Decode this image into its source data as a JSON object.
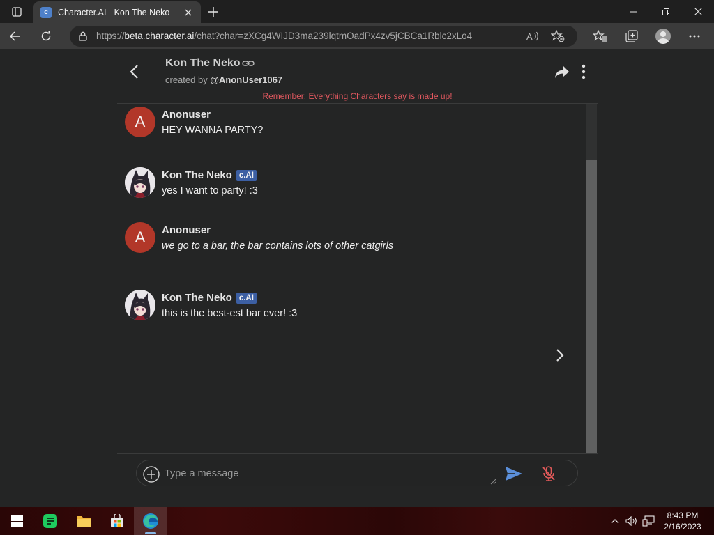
{
  "browser": {
    "tab_title": "Character.AI - Kon The Neko",
    "url_scheme": "https://",
    "url_host": "beta.character.ai",
    "url_path": "/chat?char=zXCg4WIJD3ma239lqtmOadPx4zv5jCBCa1Rblc2xLo4"
  },
  "chat": {
    "character_name": "Kon The Neko",
    "created_by_label": "created by",
    "creator_handle": "@AnonUser1067",
    "disclaimer": "Remember: Everything Characters say is made up!",
    "messages": [
      {
        "role": "user",
        "author": "Anonuser",
        "avatar_letter": "A",
        "text": "HEY WANNA PARTY?",
        "italic": false
      },
      {
        "role": "bot",
        "author": "Kon The Neko",
        "badge": "c.AI",
        "text": "yes I want to party! :3",
        "italic": false
      },
      {
        "role": "user",
        "author": "Anonuser",
        "avatar_letter": "A",
        "text": "we go to a bar, the bar contains lots of other catgirls",
        "italic": true
      },
      {
        "role": "bot",
        "author": "Kon The Neko",
        "badge": "c.AI",
        "text": "this is the best-est bar ever! :3",
        "italic": false
      }
    ],
    "input_placeholder": "Type a message"
  },
  "taskbar": {
    "time": "8:43 PM",
    "date": "2/16/2023"
  },
  "colors": {
    "disclaimer": "#e1585f",
    "user_avatar": "#b23729",
    "badge": "#3c5fa3",
    "send": "#5b8fd9",
    "mic_muted": "#e25a5a"
  }
}
